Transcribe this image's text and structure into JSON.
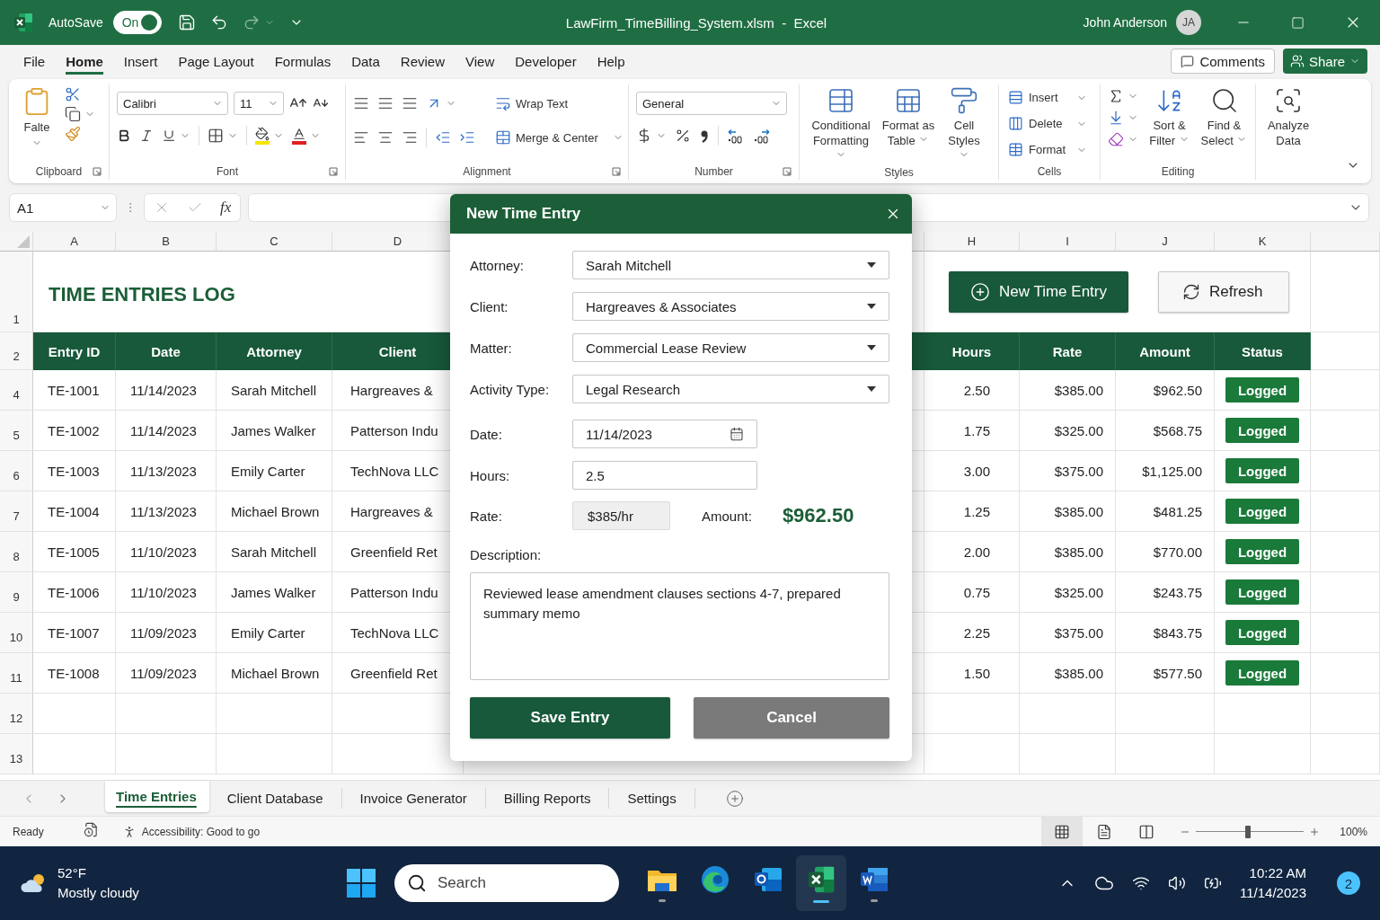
{
  "title_bar": {
    "autosave_label": "AutoSave",
    "autosave": {
      "label": "On",
      "on": true
    },
    "document_title": "LawFirm_TimeBilling_System.xlsm  -  Excel",
    "user_name": "John Anderson",
    "user_initials": "JA"
  },
  "menu_tabs": [
    {
      "label": "File",
      "selected": false
    },
    {
      "label": "Home",
      "selected": true
    },
    {
      "label": "Insert",
      "selected": false
    },
    {
      "label": "Page Layout",
      "selected": false
    },
    {
      "label": "Formulas",
      "selected": false
    },
    {
      "label": "Data",
      "selected": false
    },
    {
      "label": "Review",
      "selected": false
    },
    {
      "label": "View",
      "selected": false
    },
    {
      "label": "Developer",
      "selected": false
    },
    {
      "label": "Help",
      "selected": false
    }
  ],
  "comments_button": "Comments",
  "share_button": "Share",
  "ribbon": {
    "clipboard": {
      "paste": "Falte",
      "label": "Clipboard"
    },
    "font": {
      "name": "Calibri",
      "size": "11",
      "label": "Font"
    },
    "alignment": {
      "wrap_text": "Wrap Text",
      "merge_center": "Merge & Center",
      "label": "Alignment"
    },
    "number": {
      "format": "General",
      "label": "Number"
    },
    "styles": {
      "buttons": [
        "Conditional Formatting",
        "Format as Table",
        "Cell Styles"
      ],
      "label": "Styles"
    },
    "cells": {
      "buttons": [
        "Insert",
        "Delete",
        "Format"
      ],
      "label": "Cells"
    },
    "editing": {
      "buttons": [
        "Sort & Filter",
        "Find & Select"
      ],
      "label": "Editing"
    },
    "analyze": "Analyze Data"
  },
  "formula_bar": {
    "name_box": "A1",
    "function_label": "fx"
  },
  "sheet": {
    "column_letters": [
      "A",
      "B",
      "C",
      "D",
      "H",
      "I",
      "J",
      "K"
    ],
    "title_row_number": "1",
    "title": "TIME ENTRIES LOG",
    "actions": [
      {
        "label": "New Time Entry",
        "kind": "primary"
      },
      {
        "label": "Refresh",
        "kind": "secondary"
      }
    ],
    "header_row_number": "2",
    "columns": [
      "Entry ID",
      "Date",
      "Attorney",
      "Client",
      "Hours",
      "Rate",
      "Amount",
      "Status"
    ],
    "rows": [
      {
        "row_number": "4",
        "cells": [
          "TE-1001",
          "11/14/2023",
          "Sarah Mitchell",
          "Hargreaves &",
          "2.50",
          "$385.00",
          "$962.50",
          "Logged"
        ]
      },
      {
        "row_number": "5",
        "cells": [
          "TE-1002",
          "11/14/2023",
          "James Walker",
          "Patterson Indu",
          "1.75",
          "$325.00",
          "$568.75",
          "Logged"
        ]
      },
      {
        "row_number": "6",
        "cells": [
          "TE-1003",
          "11/13/2023",
          "Emily Carter",
          "TechNova LLC",
          "3.00",
          "$375.00",
          "$1,125.00",
          "Logged"
        ]
      },
      {
        "row_number": "7",
        "cells": [
          "TE-1004",
          "11/13/2023",
          "Michael Brown",
          "Hargreaves &",
          "1.25",
          "$385.00",
          "$481.25",
          "Logged"
        ]
      },
      {
        "row_number": "8",
        "cells": [
          "TE-1005",
          "11/10/2023",
          "Sarah Mitchell",
          "Greenfield Ret",
          "2.00",
          "$385.00",
          "$770.00",
          "Logged"
        ]
      },
      {
        "row_number": "9",
        "cells": [
          "TE-1006",
          "11/10/2023",
          "James Walker",
          "Patterson Indu",
          "0.75",
          "$325.00",
          "$243.75",
          "Logged"
        ]
      },
      {
        "row_number": "10",
        "cells": [
          "TE-1007",
          "11/09/2023",
          "Emily Carter",
          "TechNova LLC",
          "2.25",
          "$375.00",
          "$843.75",
          "Logged"
        ]
      },
      {
        "row_number": "11",
        "cells": [
          "TE-1008",
          "11/09/2023",
          "Michael Brown",
          "Greenfield Ret",
          "1.50",
          "$385.00",
          "$577.50",
          "Logged"
        ]
      }
    ],
    "empty_rows": [
      "12",
      "13"
    ]
  },
  "dialog": {
    "title": "New Time Entry",
    "fields": [
      {
        "label": "Attorney:",
        "kind": "select",
        "value": "Sarah Mitchell"
      },
      {
        "label": "Client:",
        "kind": "select",
        "value": "Hargreaves & Associates"
      },
      {
        "label": "Matter:",
        "kind": "select",
        "value": "Commercial Lease Review"
      },
      {
        "label": "Activity Type:",
        "kind": "select",
        "value": "Legal Research"
      },
      {
        "label": "Date:",
        "kind": "date",
        "value": "11/14/2023"
      },
      {
        "label": "Hours:",
        "kind": "text",
        "value": "2.5"
      },
      {
        "label": "Rate:",
        "kind": "readonly",
        "value": "$385/hr",
        "amount_label": "Amount:",
        "amount_value": "$962.50"
      }
    ],
    "description_label": "Description:",
    "description_value": "Reviewed lease amendment clauses sections 4-7, prepared summary memo",
    "buttons": [
      {
        "label": "Save Entry",
        "kind": "primary"
      },
      {
        "label": "Cancel",
        "kind": "secondary"
      }
    ]
  },
  "sheet_tabs": [
    {
      "label": "Time Entries",
      "selected": true
    },
    {
      "label": "Client Database",
      "selected": false
    },
    {
      "label": "Invoice Generator",
      "selected": false
    },
    {
      "label": "Billing Reports",
      "selected": false
    },
    {
      "label": "Settings",
      "selected": false
    }
  ],
  "status_bar": {
    "status": "Ready",
    "accessibility": "Accessibility: Good to go",
    "views": [
      {
        "kind": "normal",
        "selected": true
      },
      {
        "kind": "page_layout",
        "selected": false
      },
      {
        "kind": "page_break",
        "selected": false
      }
    ],
    "zoom": {
      "level": 0.48
    },
    "zoom_reading": "100%"
  },
  "taskbar": {
    "temperature": "52°F",
    "condition": "Mostly cloudy",
    "search": {
      "placeholder": "Search"
    },
    "apps": [
      {
        "kind": "explorer",
        "active": false,
        "running": true
      },
      {
        "kind": "edge",
        "active": false,
        "running": false
      },
      {
        "kind": "outlook",
        "active": false,
        "running": false
      },
      {
        "kind": "excel",
        "active": true,
        "running": true
      },
      {
        "kind": "word",
        "active": false,
        "running": true
      }
    ],
    "time": "10:22 AM",
    "date": "11/14/2023",
    "notifications": "2"
  }
}
